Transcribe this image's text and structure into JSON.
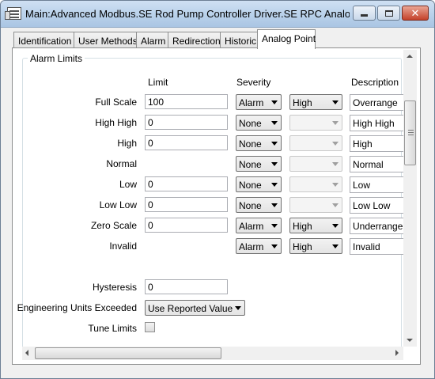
{
  "window": {
    "title": "Main:Advanced Modbus.SE Rod Pump Controller Driver.SE RPC Analog Inp...",
    "icon": "config-list-icon",
    "close_glyph": "✕"
  },
  "tabs": [
    {
      "label": "Identification",
      "active": false
    },
    {
      "label": "User Methods",
      "active": false
    },
    {
      "label": "Alarm",
      "active": false
    },
    {
      "label": "Redirection",
      "active": false
    },
    {
      "label": "Historic",
      "active": false
    },
    {
      "label": "Analog Point",
      "active": true
    }
  ],
  "alarm_limits": {
    "group_title": "Alarm Limits",
    "headers": {
      "limit": "Limit",
      "severity": "Severity",
      "description": "Description"
    },
    "rows": [
      {
        "label": "Full Scale",
        "limit": "100",
        "severity": "Alarm",
        "priority": "High",
        "priority_enabled": true,
        "description": "Overrange"
      },
      {
        "label": "High High",
        "limit": "0",
        "severity": "None",
        "priority": "",
        "priority_enabled": false,
        "description": "High High"
      },
      {
        "label": "High",
        "limit": "0",
        "severity": "None",
        "priority": "",
        "priority_enabled": false,
        "description": "High"
      },
      {
        "label": "Normal",
        "limit": null,
        "severity": "None",
        "priority": "",
        "priority_enabled": false,
        "description": "Normal"
      },
      {
        "label": "Low",
        "limit": "0",
        "severity": "None",
        "priority": "",
        "priority_enabled": false,
        "description": "Low"
      },
      {
        "label": "Low Low",
        "limit": "0",
        "severity": "None",
        "priority": "",
        "priority_enabled": false,
        "description": "Low Low"
      },
      {
        "label": "Zero Scale",
        "limit": "0",
        "severity": "Alarm",
        "priority": "High",
        "priority_enabled": true,
        "description": "Underrange"
      },
      {
        "label": "Invalid",
        "limit": null,
        "severity": "Alarm",
        "priority": "High",
        "priority_enabled": true,
        "description": "Invalid"
      }
    ]
  },
  "hysteresis": {
    "label": "Hysteresis",
    "value": "0"
  },
  "eng_units": {
    "label": "Engineering Units Exceeded",
    "value": "Use Reported Value"
  },
  "tune_limits": {
    "label": "Tune Limits",
    "checked": false
  }
}
